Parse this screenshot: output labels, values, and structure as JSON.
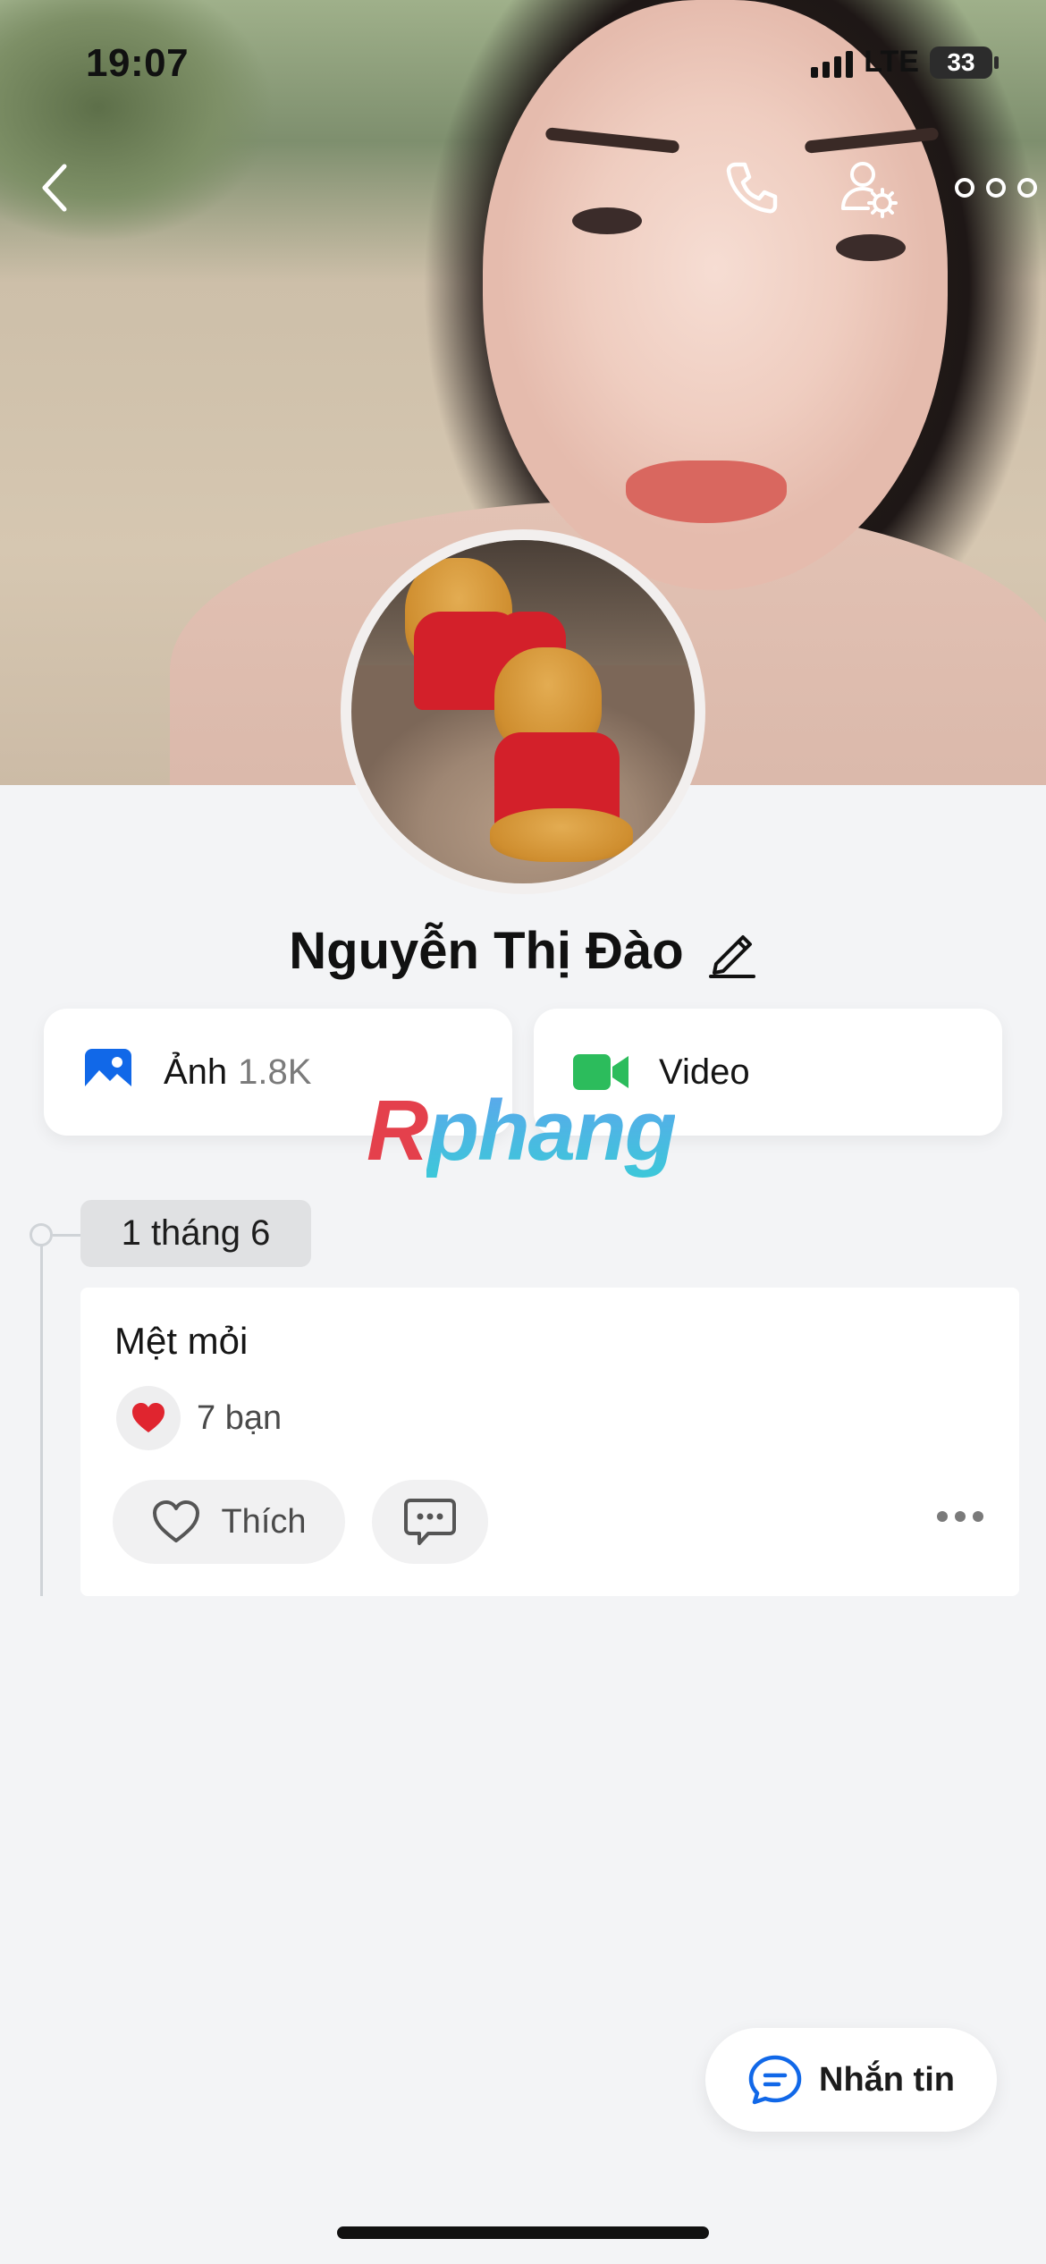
{
  "status_bar": {
    "time": "19:07",
    "network": "LTE",
    "battery": "33"
  },
  "profile": {
    "name": "Nguyễn Thị Đào"
  },
  "media_cards": {
    "photos": {
      "label": "Ảnh",
      "count": "1.8K",
      "icon": "image-icon",
      "color": "#1168e8"
    },
    "video": {
      "label": "Video",
      "icon": "video-camera-icon",
      "color": "#2cbc5c"
    }
  },
  "watermark": {
    "first": "R",
    "rest": "phang"
  },
  "timeline": {
    "date": "1 tháng 6",
    "post": {
      "text": "Mệt mỏi",
      "reaction_count": "7 bạn",
      "like_label": "Thích"
    }
  },
  "message_button": {
    "label": "Nhắn tin",
    "color": "#1168e8"
  },
  "icons": {
    "top_bar": [
      "back-icon",
      "phone-icon",
      "user-settings-icon",
      "more-icon"
    ]
  }
}
